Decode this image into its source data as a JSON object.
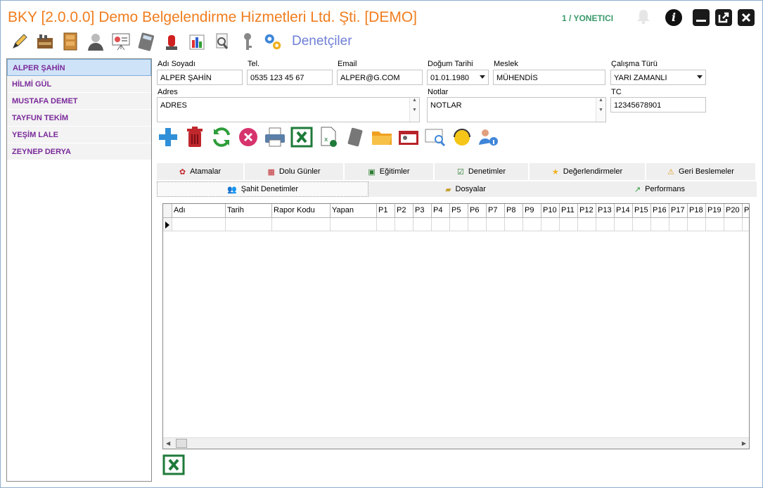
{
  "app": {
    "title": "BKY [2.0.0.0] Demo Belgelendirme Hizmetleri Ltd. Şti. [DEMO]",
    "user": "1 / YONETICI",
    "module": "Denetçiler"
  },
  "toolbar_icons": [
    "pen-icon",
    "factory-icon",
    "cabinet-icon",
    "user-icon",
    "presentation-icon",
    "calculator-icon",
    "alarm-light-icon",
    "bar-chart-icon",
    "search-document-icon",
    "key-icon",
    "gears-icon"
  ],
  "sidebar": {
    "items": [
      {
        "label": "ALPER ŞAHİN",
        "selected": true
      },
      {
        "label": "HİLMİ GÜL"
      },
      {
        "label": "MUSTAFA DEMET"
      },
      {
        "label": "TAYFUN TEKİM"
      },
      {
        "label": "YEŞİM LALE"
      },
      {
        "label": "ZEYNEP DERYA"
      }
    ]
  },
  "form": {
    "name": {
      "label": "Adı Soyadı",
      "value": "ALPER ŞAHİN"
    },
    "phone": {
      "label": "Tel.",
      "value": "0535 123 45 67"
    },
    "email": {
      "label": "Email",
      "value": "ALPER@G.COM"
    },
    "birth": {
      "label": "Doğum Tarihi",
      "value": "01.01.1980"
    },
    "job": {
      "label": "Meslek",
      "value": "MÜHENDİS"
    },
    "work": {
      "label": "Çalışma Türü",
      "value": "YARI ZAMANLI"
    },
    "address": {
      "label": "Adres",
      "value": "ADRES"
    },
    "notes": {
      "label": "Notlar",
      "value": "NOTLAR"
    },
    "tc": {
      "label": "TC",
      "value": "12345678901"
    }
  },
  "tabs_row1": [
    "Atamalar",
    "Dolu Günler",
    "Eğitimler",
    "Denetimler",
    "Değerlendirmeler",
    "Geri Beslemeler"
  ],
  "tabs_row2": [
    "Şahit Denetimler",
    "Dosyalar",
    "Performans"
  ],
  "grid": {
    "columns": [
      "Adı",
      "Tarih",
      "Rapor Kodu",
      "Yapan",
      "P1",
      "P2",
      "P3",
      "P4",
      "P5",
      "P6",
      "P7",
      "P8",
      "P9",
      "P10",
      "P11",
      "P12",
      "P13",
      "P14",
      "P15",
      "P16",
      "P17",
      "P18",
      "P19",
      "P20",
      "P"
    ]
  },
  "colors": {
    "title": "#f07d1e",
    "module": "#6f7fd7",
    "sidebar_text": "#7a2a9a",
    "user": "#3a9a6a"
  }
}
